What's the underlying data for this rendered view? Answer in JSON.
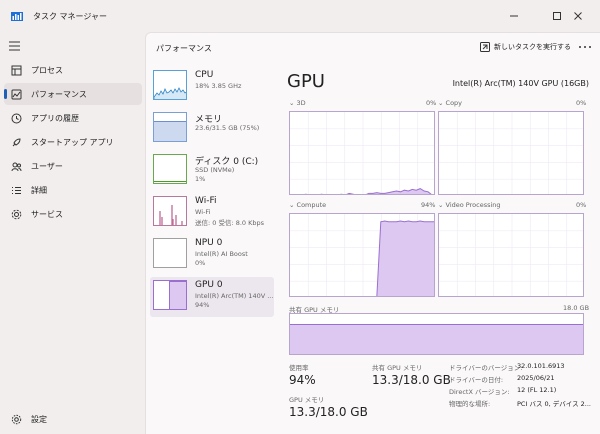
{
  "window": {
    "title": "タスク マネージャー"
  },
  "sidebar": {
    "items": [
      {
        "label": "プロセス",
        "icon": "processes-icon"
      },
      {
        "label": "パフォーマンス",
        "icon": "performance-icon"
      },
      {
        "label": "アプリの履歴",
        "icon": "app-history-icon"
      },
      {
        "label": "スタートアップ アプリ",
        "icon": "startup-apps-icon"
      },
      {
        "label": "ユーザー",
        "icon": "users-icon"
      },
      {
        "label": "詳細",
        "icon": "details-icon"
      },
      {
        "label": "サービス",
        "icon": "services-icon"
      }
    ],
    "settings_label": "設定"
  },
  "header": {
    "title": "パフォーマンス",
    "run_task_label": "新しいタスクを実行する"
  },
  "devices": [
    {
      "title": "CPU",
      "sub1": "18%  3.85 GHz",
      "sub2": ""
    },
    {
      "title": "メモリ",
      "sub1": "23.6/31.5 GB (75%)",
      "sub2": ""
    },
    {
      "title": "ディスク 0 (C:)",
      "sub1": "SSD (NVMe)",
      "sub2": "1%"
    },
    {
      "title": "Wi-Fi",
      "sub1": "Wi-Fi",
      "sub2": "送信: 0 受信: 8.0 Kbps"
    },
    {
      "title": "NPU 0",
      "sub1": "Intel(R) AI Boost",
      "sub2": "0%"
    },
    {
      "title": "GPU 0",
      "sub1": "Intel(R) Arc(TM) 140V ...",
      "sub2": "94%"
    }
  ],
  "gpu": {
    "title": "GPU",
    "model": "Intel(R) Arc(TM) 140V GPU (16GB)",
    "engines": [
      {
        "name": "3D",
        "pct": "0%",
        "samples": [
          0,
          0,
          0,
          0,
          1,
          0,
          0,
          0,
          1,
          0,
          0,
          0,
          0,
          1,
          0,
          2,
          1,
          0,
          0,
          0,
          2,
          2,
          3,
          2,
          2,
          3,
          4,
          5,
          4,
          6,
          5,
          7,
          6,
          8,
          5,
          4,
          0,
          0
        ]
      },
      {
        "name": "Copy",
        "pct": "0%",
        "samples": [
          0,
          0,
          0,
          0,
          0,
          0,
          0,
          0,
          0,
          0,
          0,
          0,
          0,
          0,
          0,
          0,
          0,
          0,
          0,
          0,
          0,
          0,
          0,
          0,
          0,
          0,
          0,
          0,
          0,
          0,
          0,
          0,
          0,
          0,
          0,
          0,
          0,
          0
        ]
      },
      {
        "name": "Compute",
        "pct": "94%",
        "samples": [
          0,
          0,
          0,
          0,
          0,
          0,
          0,
          0,
          0,
          0,
          0,
          0,
          0,
          0,
          0,
          0,
          0,
          0,
          0,
          0,
          0,
          0,
          0,
          94,
          95,
          94,
          94,
          94,
          95,
          94,
          95,
          94,
          94,
          95,
          94,
          94,
          94,
          94
        ]
      },
      {
        "name": "Video Processing",
        "pct": "0%",
        "samples": [
          0,
          0,
          0,
          0,
          0,
          0,
          0,
          0,
          0,
          0,
          0,
          0,
          0,
          0,
          0,
          0,
          0,
          0,
          0,
          0,
          0,
          0,
          0,
          0,
          0,
          0,
          0,
          0,
          0,
          0,
          0,
          0,
          0,
          0,
          0,
          0,
          0,
          0
        ]
      }
    ],
    "shared_memory_label": "共有 GPU メモリ",
    "shared_memory_max": "18.0 GB",
    "shared_memory_fraction": 0.74,
    "stats": {
      "usage_label": "使用率",
      "usage_value": "94%",
      "shared_label": "共有 GPU メモリ",
      "shared_value": "13.3/18.0 GB",
      "gpu_mem_label": "GPU メモリ",
      "gpu_mem_value": "13.3/18.0 GB"
    },
    "info": [
      {
        "k": "ドライバーのバージョン:",
        "v": "32.0.101.6913"
      },
      {
        "k": "ドライバーの日付:",
        "v": "2025/06/21"
      },
      {
        "k": "DirectX バージョン:",
        "v": "12 (FL 12.1)"
      },
      {
        "k": "物理的な場所:",
        "v": "PCI バス 0, デバイス 2..."
      }
    ]
  },
  "colors": {
    "accent": "#1f5fb8",
    "gpu_line": "#9b6fd0",
    "gpu_fill": "#dcc8f0",
    "mem_fill": "#cdd9ef"
  }
}
